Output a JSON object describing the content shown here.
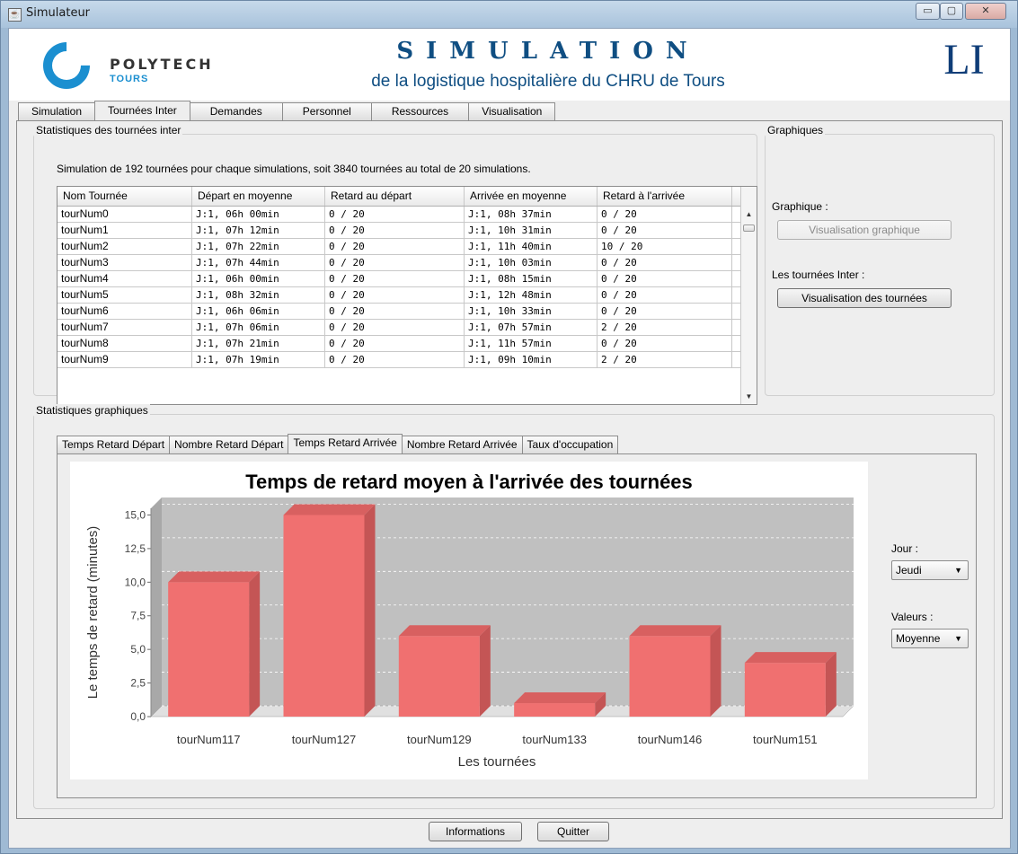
{
  "window": {
    "title": "Simulateur",
    "controls": {
      "minimize": "▭",
      "maximize": "▢",
      "close": "✕"
    }
  },
  "header": {
    "logo_text": "POLYTECH",
    "logo_sub": "TOURS",
    "title": "SIMULATION",
    "subtitle": "de la logistique hospitalière du CHRU de Tours",
    "lab_logo": "LI"
  },
  "tabs": [
    "Simulation",
    "Tournées Inter",
    "Demandes",
    "Personnel",
    "Ressources",
    "Visualisation"
  ],
  "active_tab": "Tournées Inter",
  "stats": {
    "group_label": "Statistiques des tournées inter",
    "summary": "Simulation de 192 tournées pour chaque simulations, soit 3840 tournées au total de 20 simulations.",
    "columns": [
      "Nom Tournée",
      "Départ en moyenne",
      "Retard au départ",
      "Arrivée en moyenne",
      "Retard à l'arrivée"
    ],
    "rows": [
      [
        "tourNum0",
        "J:1, 06h 00min",
        "0 / 20",
        "J:1, 08h 37min",
        "0 / 20"
      ],
      [
        "tourNum1",
        "J:1, 07h 12min",
        "0 / 20",
        "J:1, 10h 31min",
        "0 / 20"
      ],
      [
        "tourNum2",
        "J:1, 07h 22min",
        "0 / 20",
        "J:1, 11h 40min",
        "10 / 20"
      ],
      [
        "tourNum3",
        "J:1, 07h 44min",
        "0 / 20",
        "J:1, 10h 03min",
        "0 / 20"
      ],
      [
        "tourNum4",
        "J:1, 06h 00min",
        "0 / 20",
        "J:1, 08h 15min",
        "0 / 20"
      ],
      [
        "tourNum5",
        "J:1, 08h 32min",
        "0 / 20",
        "J:1, 12h 48min",
        "0 / 20"
      ],
      [
        "tourNum6",
        "J:1, 06h 06min",
        "0 / 20",
        "J:1, 10h 33min",
        "0 / 20"
      ],
      [
        "tourNum7",
        "J:1, 07h 06min",
        "0 / 20",
        "J:1, 07h 57min",
        "2 / 20"
      ],
      [
        "tourNum8",
        "J:1, 07h 21min",
        "0 / 20",
        "J:1, 11h 57min",
        "0 / 20"
      ],
      [
        "tourNum9",
        "J:1, 07h 19min",
        "0 / 20",
        "J:1, 09h 10min",
        "2 / 20"
      ]
    ]
  },
  "graphiques": {
    "group_label": "Graphiques",
    "graph_label": "Graphique :",
    "graph_button": "Visualisation graphique",
    "tours_label": "Les tournées Inter :",
    "tours_button": "Visualisation des tournées"
  },
  "chart_section": {
    "group_label": "Statistiques graphiques",
    "tabs": [
      "Temps Retard Départ",
      "Nombre Retard Départ",
      "Temps Retard Arrivée",
      "Nombre Retard Arrivée",
      "Taux d'occupation"
    ],
    "active_tab": "Temps Retard Arrivée",
    "jour_label": "Jour :",
    "jour_value": "Jeudi",
    "valeurs_label": "Valeurs :",
    "valeurs_value": "Moyenne"
  },
  "chart_data": {
    "type": "bar",
    "title": "Temps de retard moyen à l'arrivée des tournées",
    "xlabel": "Les tournées",
    "ylabel": "Le temps de retard (minutes)",
    "categories": [
      "tourNum117",
      "tourNum127",
      "tourNum129",
      "tourNum133",
      "tourNum146",
      "tourNum151"
    ],
    "values": [
      10,
      15,
      6,
      1,
      6,
      4
    ],
    "ylim": [
      0,
      15.5
    ],
    "yticks": [
      "0,0",
      "2,5",
      "5,0",
      "7,5",
      "10,0",
      "12,5",
      "15,0"
    ],
    "bar_color": "#f07070",
    "plot_bg": "#c0c0c0",
    "grid": true
  },
  "footer": {
    "info_button": "Informations",
    "quit_button": "Quitter"
  }
}
